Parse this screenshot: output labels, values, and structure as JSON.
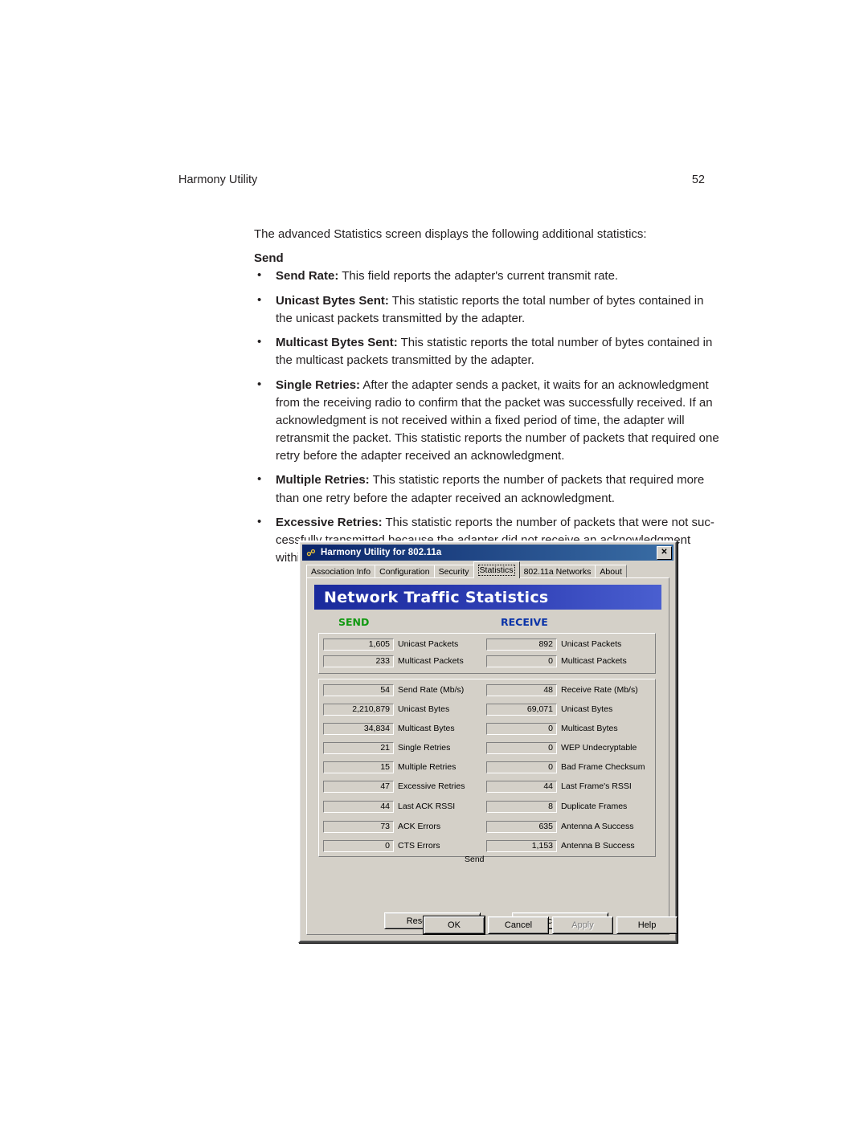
{
  "runhead": {
    "left": "Harmony Utility",
    "right": "52"
  },
  "body": {
    "intro": "The advanced Statistics screen displays the following additional statistics:",
    "section_heading": "Send",
    "bullets": [
      {
        "term": "Send Rate:",
        "text": " This field reports the adapter's current transmit rate."
      },
      {
        "term": "Unicast Bytes Sent:",
        "text": " This statistic reports the total number of bytes contained in the unicast packets transmitted by the adapter."
      },
      {
        "term": "Multicast Bytes Sent:",
        "text": " This statistic reports the total number of bytes contained in the multicast packets transmitted by the adapter."
      },
      {
        "term": "Single Retries:",
        "text": " After the adapter sends a packet, it waits for an acknowledgment from the receiving radio to confirm that the packet was successfully received.  If an acknowledgment is not received within a fixed period of time, the adapter will retransmit the packet.  This statistic reports the number of packets that required one retry before the adapter received an acknowledgment."
      },
      {
        "term": "Multiple Retries:",
        "text": " This statistic reports the number of packets that required more than one retry before the adapter received an acknowledgment."
      },
      {
        "term": "Excessive Retries:",
        "text": " This statistic reports the number of packets that were not suc-cessfully transmitted because the adapter did not receive an acknowledgment within the maximum number of retries."
      }
    ]
  },
  "dialog": {
    "title": "Harmony Utility for 802.11a",
    "title_icon": "antenna-icon",
    "close_label": "✕",
    "tabs": [
      {
        "label": "Association Info",
        "active": false
      },
      {
        "label": "Configuration",
        "active": false
      },
      {
        "label": "Security",
        "active": false
      },
      {
        "label": "Statistics",
        "active": true
      },
      {
        "label": "802.11a Networks",
        "active": false
      },
      {
        "label": "About",
        "active": false
      }
    ],
    "banner": "Network Traffic Statistics",
    "columns": {
      "send": "SEND",
      "receive": "RECEIVE"
    },
    "send_floating_label": "Send",
    "top_group": {
      "send": [
        {
          "value": "1,605",
          "label": "Unicast Packets"
        },
        {
          "value": "233",
          "label": "Multicast Packets"
        }
      ],
      "receive": [
        {
          "value": "892",
          "label": "Unicast Packets"
        },
        {
          "value": "0",
          "label": "Multicast Packets"
        }
      ]
    },
    "main_group": {
      "send": [
        {
          "value": "54",
          "label": "Send Rate (Mb/s)"
        },
        {
          "value": "2,210,879",
          "label": "Unicast Bytes"
        },
        {
          "value": "34,834",
          "label": "Multicast Bytes"
        },
        {
          "value": "21",
          "label": "Single Retries"
        },
        {
          "value": "15",
          "label": "Multiple Retries"
        },
        {
          "value": "47",
          "label": "Excessive Retries"
        },
        {
          "value": "44",
          "label": "Last ACK RSSI"
        },
        {
          "value": "73",
          "label": "ACK Errors"
        },
        {
          "value": "0",
          "label": "CTS Errors"
        }
      ],
      "receive": [
        {
          "value": "48",
          "label": "Receive Rate (Mb/s)"
        },
        {
          "value": "69,071",
          "label": "Unicast Bytes"
        },
        {
          "value": "0",
          "label": "Multicast Bytes"
        },
        {
          "value": "0",
          "label": "WEP Undecryptable"
        },
        {
          "value": "0",
          "label": "Bad Frame Checksum"
        },
        {
          "value": "44",
          "label": "Last Frame's RSSI"
        },
        {
          "value": "8",
          "label": "Duplicate Frames"
        },
        {
          "value": "635",
          "label": "Antenna A Success"
        },
        {
          "value": "1,153",
          "label": "Antenna B Success"
        }
      ]
    },
    "buttons": {
      "reset": "Reset Values",
      "basic": "Basic Statistics",
      "ok": "OK",
      "cancel": "Cancel",
      "apply": "Apply",
      "help": "Help"
    }
  },
  "colors": {
    "send_heading": "#119911",
    "receive_heading": "#0a33a8",
    "titlebar": "#0a246a",
    "banner": "#2f3fb5",
    "dialog_face": "#d4d0c8"
  }
}
